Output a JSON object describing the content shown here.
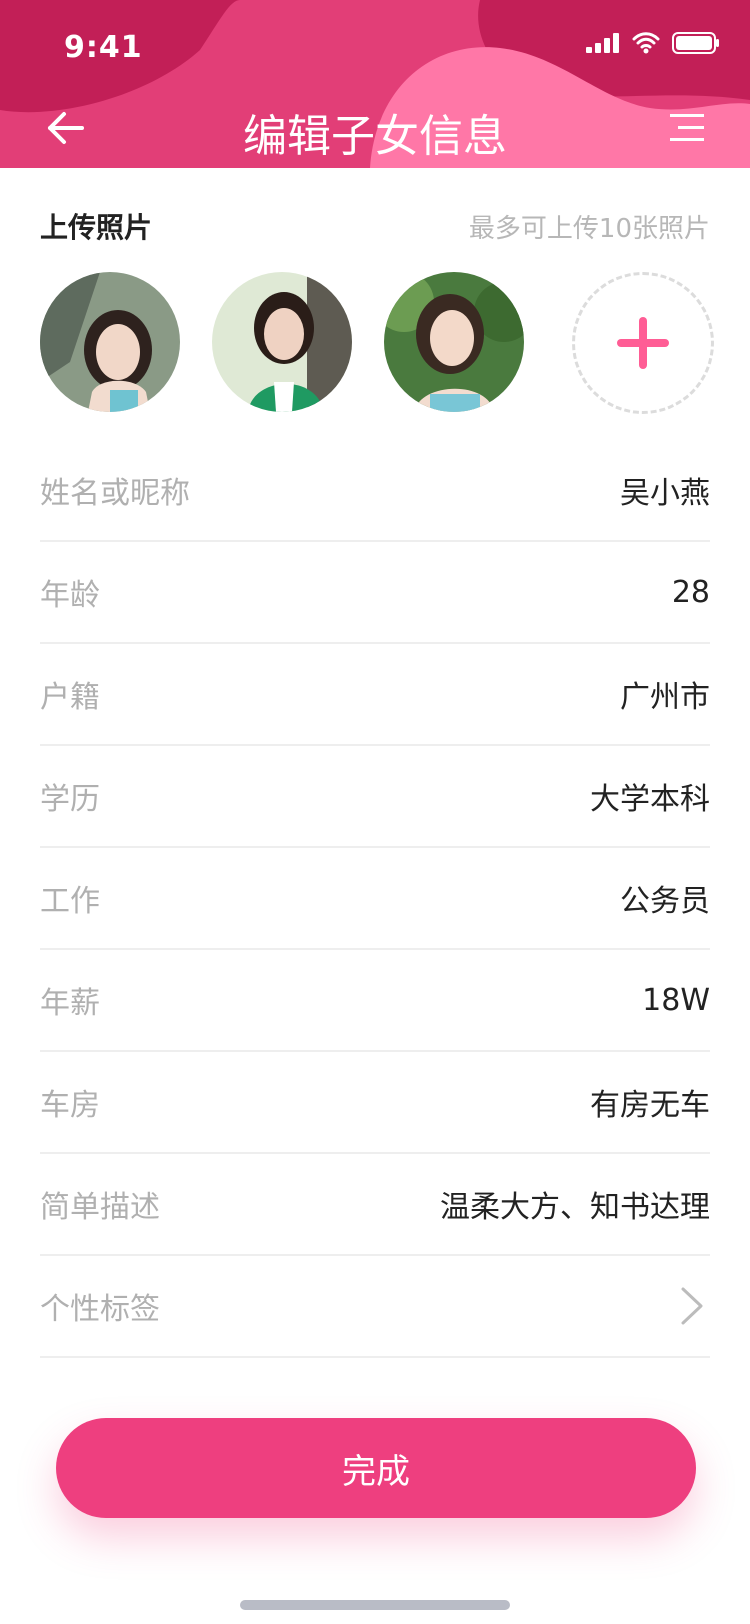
{
  "status_bar": {
    "time": "9:41"
  },
  "header": {
    "title": "编辑子女信息"
  },
  "upload": {
    "title": "上传照片",
    "hint": "最多可上传10张照片"
  },
  "fields": [
    {
      "label": "姓名或昵称",
      "value": "吴小燕"
    },
    {
      "label": "年龄",
      "value": "28"
    },
    {
      "label": "户籍",
      "value": "广州市"
    },
    {
      "label": "学历",
      "value": "大学本科"
    },
    {
      "label": "工作",
      "value": "公务员"
    },
    {
      "label": "年薪",
      "value": "18W"
    },
    {
      "label": "车房",
      "value": "有房无车"
    },
    {
      "label": "简单描述",
      "value": "温柔大方、知书达理"
    },
    {
      "label": "个性标签",
      "value": ""
    }
  ],
  "button": {
    "label": "完成"
  },
  "colors": {
    "header": "#c8225a",
    "header_accent": "#ff75a6",
    "accent": "#ee3f7f"
  },
  "icons": [
    "back-arrow-icon",
    "menu-icon",
    "plus-icon",
    "chevron-right-icon",
    "signal-icon",
    "wifi-icon",
    "battery-icon"
  ]
}
